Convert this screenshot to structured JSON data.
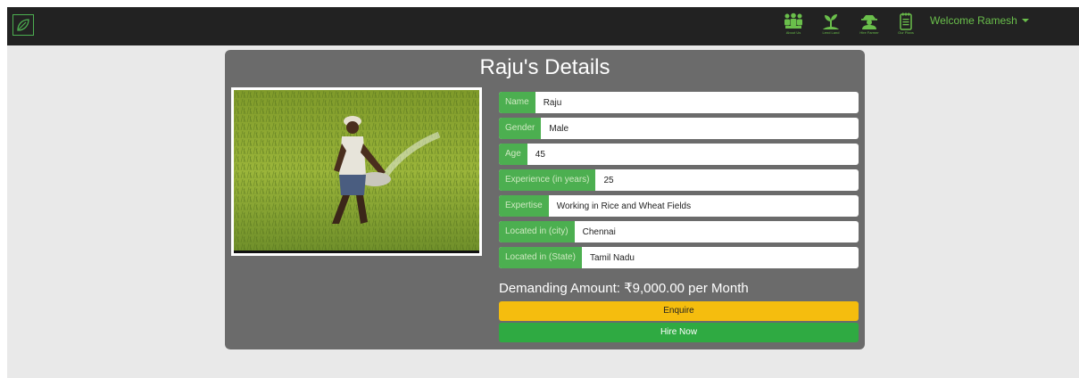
{
  "nav": {
    "items": [
      {
        "icon": "people-icon",
        "caption": "About Us"
      },
      {
        "icon": "plant-icon",
        "caption": "Lend Land"
      },
      {
        "icon": "farmer-icon",
        "caption": "Hire Farmer"
      },
      {
        "icon": "notepad-icon",
        "caption": "Our Plans"
      }
    ],
    "welcome": "Welcome Ramesh"
  },
  "details": {
    "title": "Raju's Details",
    "fields": [
      {
        "label": "Name",
        "value": "Raju"
      },
      {
        "label": "Gender",
        "value": "Male"
      },
      {
        "label": "Age",
        "value": "45"
      },
      {
        "label": "Experience (in years)",
        "value": "25"
      },
      {
        "label": "Expertise",
        "value": "Working in Rice and Wheat Fields"
      },
      {
        "label": "Located in (city)",
        "value": "Chennai"
      },
      {
        "label": "Located in (State)",
        "value": "Tamil Nadu"
      }
    ],
    "amount": "Demanding Amount: ₹9,000.00 per Month",
    "enquire_label": "Enquire",
    "hire_label": "Hire Now"
  },
  "colors": {
    "navbar": "#222222",
    "accent_green": "#4caf50",
    "card": "#6b6b6b",
    "enquire": "#f5bd0e",
    "hire": "#2faa42"
  }
}
